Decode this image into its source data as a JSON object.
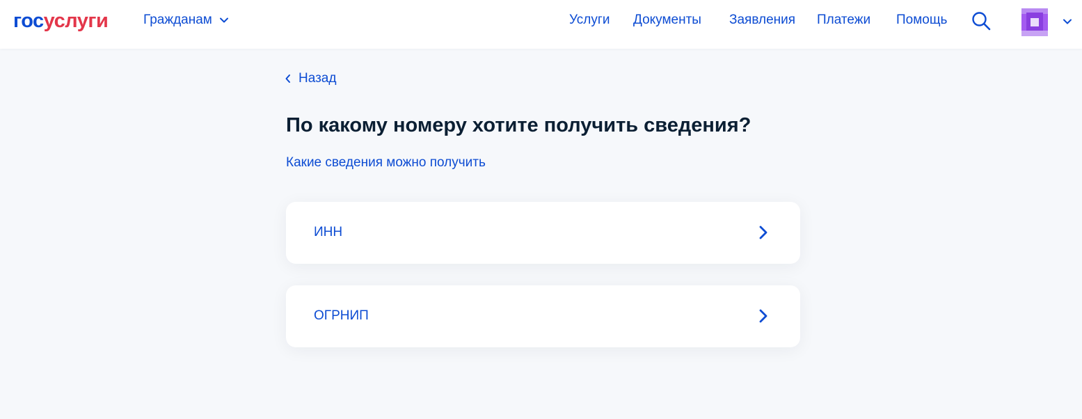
{
  "header": {
    "logo": {
      "part1": "гос",
      "part2": "услуги"
    },
    "audience_label": "Гражданам",
    "nav": [
      "Услуги",
      "Документы",
      "Заявления",
      "Платежи",
      "Помощь"
    ],
    "search_icon": "search-icon",
    "avatar_icon": "avatar-pixelated",
    "profile_menu_icon": "chevron-down-icon"
  },
  "main": {
    "back_label": "Назад",
    "title": "По какому номеру хотите получить сведения?",
    "info_link": "Какие сведения можно получить",
    "options": [
      {
        "label": "ИНН",
        "icon": "chevron-right-icon"
      },
      {
        "label": "ОГРНИП",
        "icon": "chevron-right-icon"
      }
    ]
  },
  "colors": {
    "brand_blue": "#0d4cd3",
    "brand_red": "#e3364a",
    "text_dark": "#0b1f33",
    "page_bg": "#f6f8fb",
    "avatar_purple": "#9b4fe6"
  }
}
